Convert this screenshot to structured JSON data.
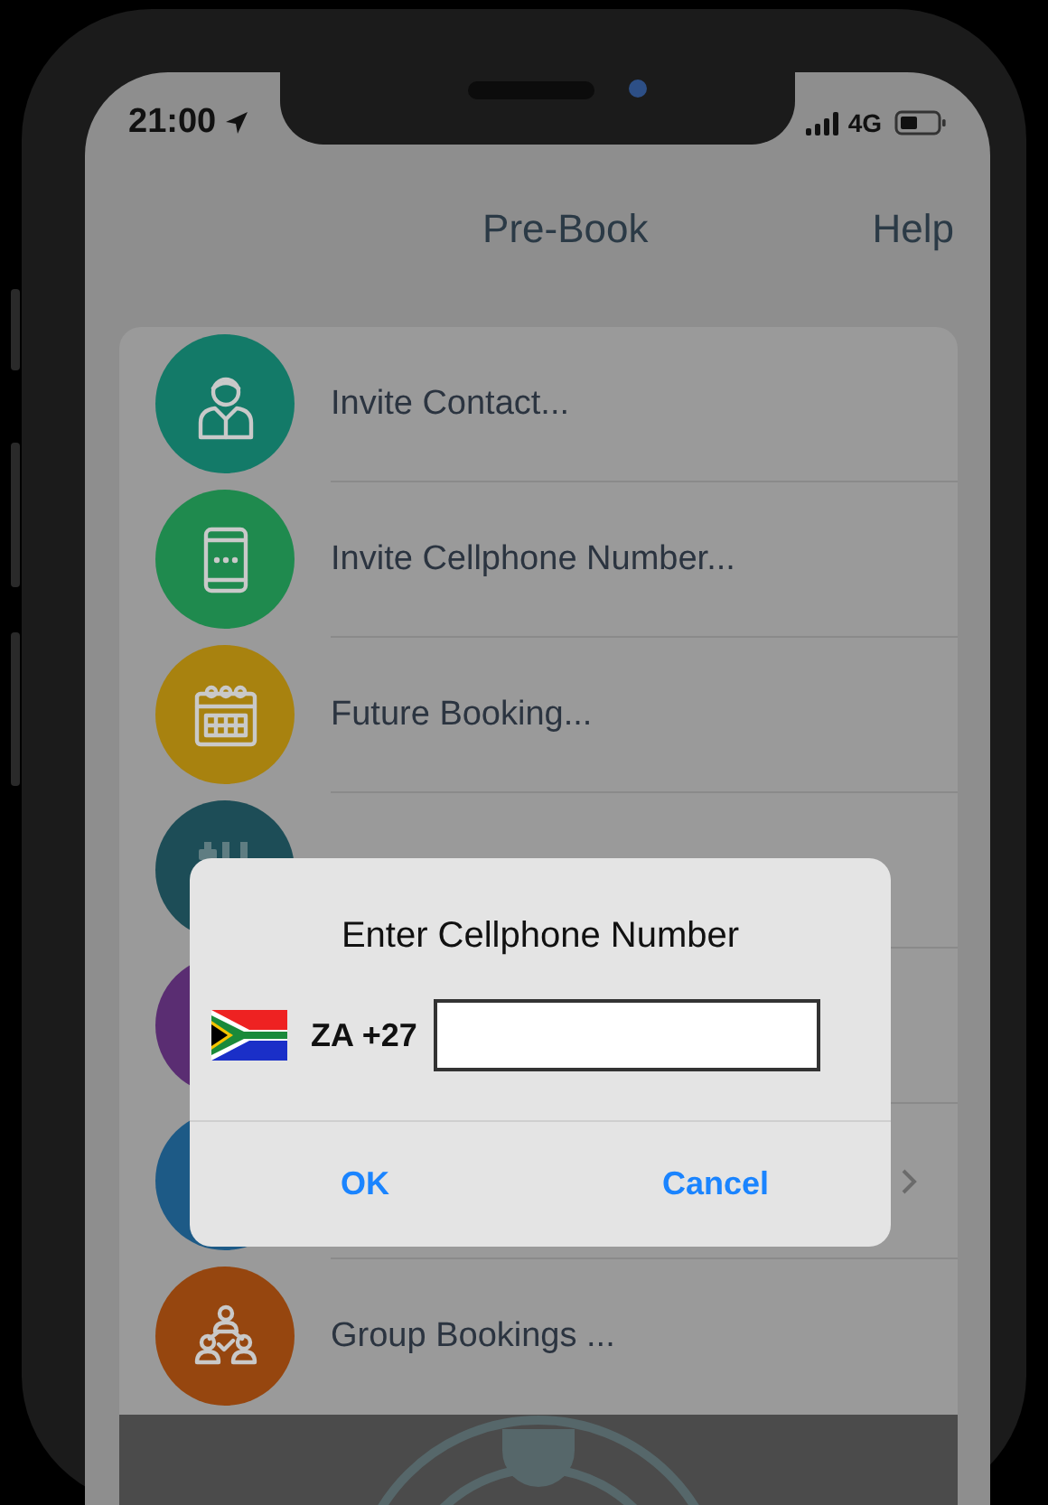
{
  "status_bar": {
    "time": "21:00",
    "network": "4G"
  },
  "nav": {
    "title": "Pre-Book",
    "action": "Help"
  },
  "rows": [
    {
      "label": "Invite Contact...",
      "color": "#137a68",
      "chevron": false
    },
    {
      "label": "Invite Cellphone Number...",
      "color": "#1f8a4e",
      "chevron": false
    },
    {
      "label": "Future Booking...",
      "color": "#a8820f",
      "chevron": false
    },
    {
      "color": "#1d4d57",
      "chevron": false
    },
    {
      "color": "#5a2d72",
      "chevron": false
    },
    {
      "color": "#1d5a86",
      "chevron": true
    },
    {
      "label": "Group Bookings ...",
      "color": "#96460f",
      "chevron": false
    }
  ],
  "dialog": {
    "title": "Enter Cellphone Number",
    "country": "ZA +27",
    "buttons": [
      "OK",
      "Cancel"
    ]
  }
}
